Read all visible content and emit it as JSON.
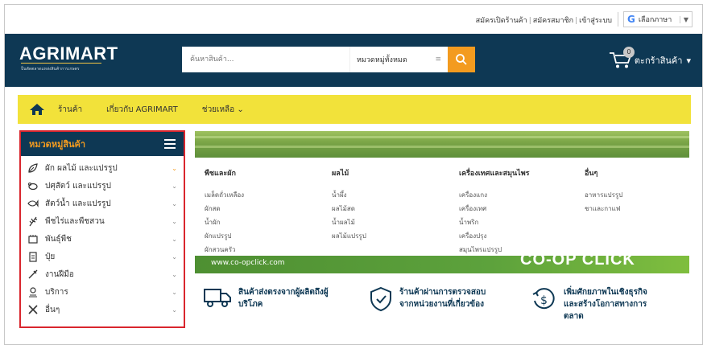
{
  "topbar": {
    "links": [
      "สมัครเปิดร้านค้า",
      "สมัครสมาชิก",
      "เข้าสู่ระบบ"
    ],
    "separator": "|",
    "language_label": "เลือกภาษา",
    "google_letter": "G",
    "language_arrow": "▼"
  },
  "header": {
    "logo": "AGRIMART",
    "logo_sub": "ป็นตัดตลาดแหล่งสินค้าการเกษตร",
    "search_placeholder": "ค้นหาสินค้า...",
    "category_select": "หมวดหมู่ทั้งหมด",
    "category_chevron": "≡",
    "cart_count": "0",
    "cart_label": "ตะกร้าสินค้า",
    "cart_arrow": "▾"
  },
  "nav": {
    "items": [
      "ร้านค้า",
      "เกี่ยวกับ AGRIMART",
      "ช่วยเหลือ ⌄"
    ]
  },
  "sidebar": {
    "title": "หมวดหมู่สินค้า",
    "items": [
      {
        "label": "ผัก ผลไม้ และแปรรูป",
        "icon": "vegetable-icon",
        "chevron": "⌄"
      },
      {
        "label": "ปศุสัตว์ และแปรรูป",
        "icon": "livestock-icon",
        "chevron": "⌄"
      },
      {
        "label": "สัตว์น้ำ และแปรรูป",
        "icon": "fish-icon",
        "chevron": "⌄"
      },
      {
        "label": "พืชไร่และพืชสวน",
        "icon": "crop-icon",
        "chevron": "⌄"
      },
      {
        "label": "พันธุ์พืช",
        "icon": "seed-icon",
        "chevron": "⌄"
      },
      {
        "label": "ปุ๋ย",
        "icon": "fertilizer-icon",
        "chevron": "⌄"
      },
      {
        "label": "งานฝีมือ",
        "icon": "craft-icon",
        "chevron": "⌄"
      },
      {
        "label": "บริการ",
        "icon": "service-icon",
        "chevron": "⌄"
      },
      {
        "label": "อื่นๆ",
        "icon": "tools-icon",
        "chevron": "⌄"
      }
    ]
  },
  "mega_menu": {
    "columns": [
      {
        "heading": "พืชและผัก",
        "links": [
          "เมล็ดถั่วเหลือง",
          "ผักสด",
          "น้ำผัก",
          "ผักแปรรูป",
          "ผักสวนครัว"
        ]
      },
      {
        "heading": "ผลไม้",
        "links": [
          "น้ำผึ้ง",
          "ผลไม้สด",
          "น้ำผลไม้",
          "ผลไม้แปรรูป"
        ]
      },
      {
        "heading": "เครื่องเทศและสมุนไพร",
        "links": [
          "เครื่องแกง",
          "เครื่องเทศ",
          "น้ำพริก",
          "เครื่องปรุง",
          "สมุนไพรแปรรูป"
        ]
      },
      {
        "heading": "อื่นๆ",
        "links": [
          "อาหารแปรรูป",
          "ชาและกาแฟ"
        ]
      }
    ]
  },
  "banner": {
    "url": "www.co-opclick.com",
    "brand": "CO-OP CLICK"
  },
  "features": [
    {
      "icon": "delivery-truck-icon",
      "lines": [
        "สินค้าส่งตรงจากผู้ผลิตถึงผู้",
        "บริโภค"
      ]
    },
    {
      "icon": "verified-shield-icon",
      "lines": [
        "ร้านค้าผ่านการตรวจสอบ",
        "จากหน่วยงานที่เกี่ยวข้อง"
      ]
    },
    {
      "icon": "dollar-growth-icon",
      "lines": [
        "เพิ่มศักยภาพในเชิงธุรกิจ",
        "และสร้างโอกาสทางการ",
        "ตลาด"
      ]
    }
  ],
  "colors": {
    "header_bg": "#0e3854",
    "accent_orange": "#f39b1f",
    "nav_yellow": "#f2e23a",
    "sidebar_border": "#d9262e"
  }
}
